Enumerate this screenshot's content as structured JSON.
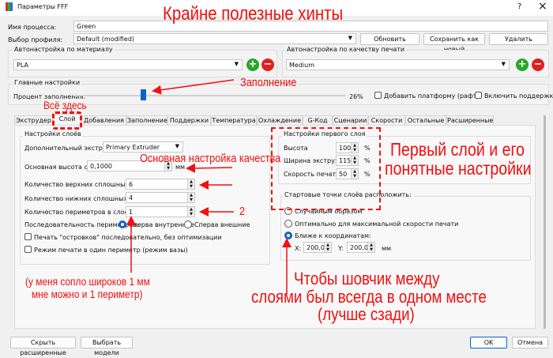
{
  "window": {
    "title": "Параметры FFF",
    "help": "?",
    "close": "×"
  },
  "header": {
    "process_label": "Имя процесса:",
    "process_value": "Green",
    "profile_label": "Выбор профиля:",
    "profile_value": "Default (modified)",
    "update": "Обновить профиль",
    "save_new": "Сохранить как новый",
    "delete": "Удалить"
  },
  "material": {
    "title": "Автонастройка по  материалу",
    "value": "PLA"
  },
  "quality": {
    "title": "Автонастройка по качеству печати",
    "value": "Medium"
  },
  "main": {
    "title": "Главные настройки",
    "infill_label": "Процент заполнения:",
    "infill_value": "26%",
    "infill_fraction": 0.26,
    "raft": "Добавить платформу (рафт)",
    "supports": "Включить поддержки"
  },
  "tabs": [
    "Экструдер",
    "Слой",
    "Добавления",
    "Заполнение",
    "Поддержки",
    "Температура",
    "Охлаждение",
    "G-Код",
    "Сценарии",
    "Скорости",
    "Остальные",
    "Расширенные"
  ],
  "layers": {
    "title": "Настройки слоёв",
    "extruder_label": "Дополнительный экструдер",
    "extruder_value": "Primary Extruder",
    "height_label": "Основная высота слоя",
    "height_value": "0,1000",
    "height_unit": "мм",
    "top_label": "Количество верхних сплошных слоёв",
    "top_value": "6",
    "bottom_label": "Количество нижних сплошных слоев",
    "bottom_value": "4",
    "perim_label": "Количество периметров в слое",
    "perim_value": "1",
    "order_label": "Последовательность периметров:",
    "order_inner": "Сперва внутренние",
    "order_outer": "Сперва внешние",
    "islands": "Печать \"островков\" последовательно, без оптимизации",
    "vase": "Режим печати в один периметр (режим вазы)"
  },
  "first_layer": {
    "title": "Настройки первого слоя",
    "height_label": "Высота",
    "height_value": "100",
    "width_label": "Ширина экструзии",
    "width_value": "115",
    "speed_label": "Скорость печати",
    "speed_value": "50",
    "unit": "%"
  },
  "start": {
    "title": "Стартовые точки слоёв расположить:",
    "random": "Случайным образом",
    "optimal": "Оптимально для максимальной скорости печати",
    "nearest": "Ближе к координатам:",
    "x_label": "X:",
    "x_value": "200,0",
    "y_label": "Y:",
    "y_value": "200,0",
    "unit": "мм"
  },
  "footer": {
    "hide": "Скрыть расширенные",
    "models": "Выбрать модели",
    "ok": "OK",
    "cancel": "Отмена"
  },
  "notes": {
    "title": "Крайне полезные хинты",
    "infill": "Заполнение",
    "all_here": "Всё здесь",
    "quality": "Основная настройка качества",
    "first_layer_1": "Первый слой и его",
    "first_layer_2": "понятные настройки",
    "two": "2",
    "nozzle_1": "(у меня сопло широков 1 мм",
    "nozzle_2": "мне можно и 1 периметр)",
    "seam_1": "Чтобы шовчик между",
    "seam_2": "слоями был всегда в одном месте",
    "seam_3": "(лучше сзади)"
  },
  "colors": {
    "annotation": "#f01010",
    "accent": "#0a64c8"
  }
}
